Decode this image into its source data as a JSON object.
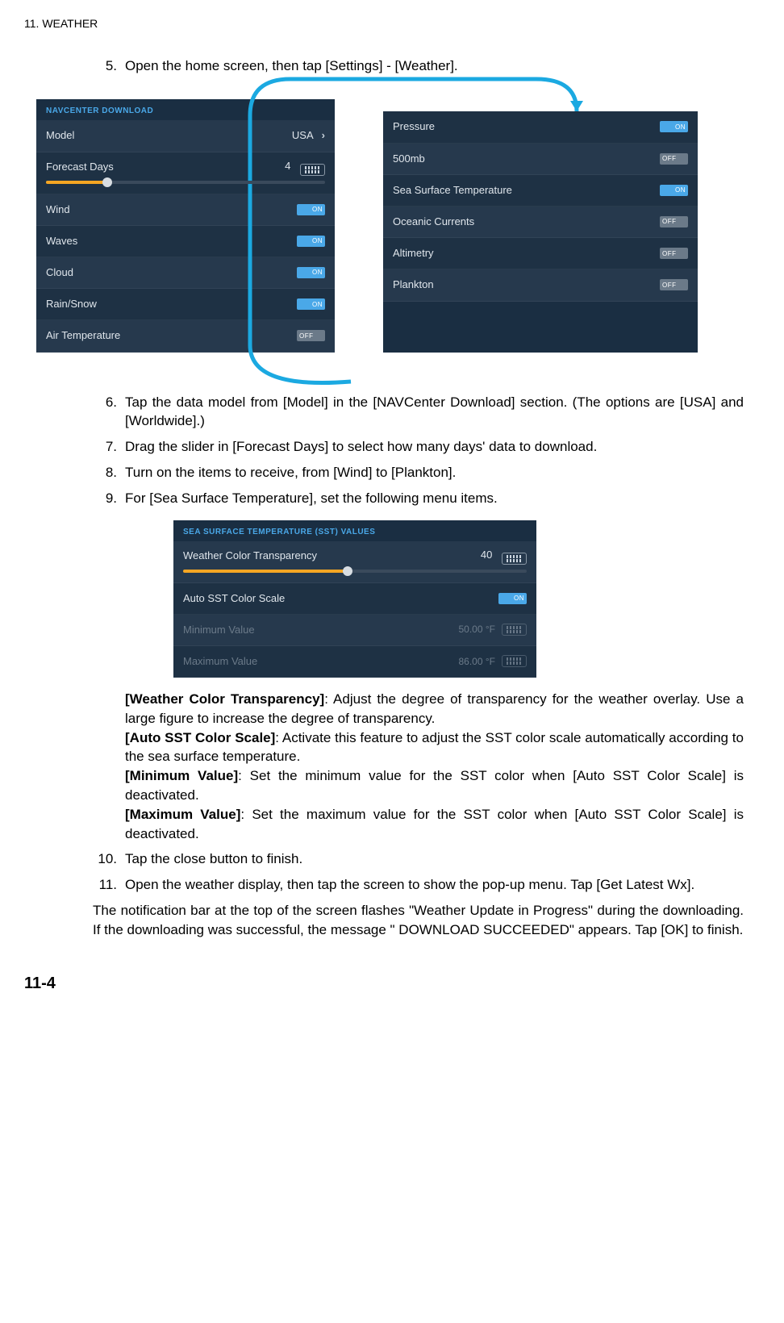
{
  "header": {
    "chapter": "11.  WEATHER"
  },
  "steps": {
    "s5": {
      "num": "5.",
      "text": "Open the home screen, then tap [Settings] - [Weather]."
    },
    "s6": {
      "num": "6.",
      "text": "Tap the data model from [Model] in the [NAVCenter Download] section. (The options are [USA] and [Worldwide].)"
    },
    "s7": {
      "num": "7.",
      "text": "Drag the slider in [Forecast Days] to select how many days' data to download."
    },
    "s8": {
      "num": "8.",
      "text": "Turn on the items to receive, from [Wind] to [Plankton]."
    },
    "s9": {
      "num": "9.",
      "text": "For [Sea Surface Temperature], set the following menu items."
    },
    "s10": {
      "num": "10.",
      "text": "Tap the close button to finish."
    },
    "s11": {
      "num": "11.",
      "text": "Open the weather display, then tap the screen to show the pop-up menu. Tap [Get Latest Wx]."
    }
  },
  "panelLeft": {
    "header": "NAVCENTER DOWNLOAD",
    "model": {
      "label": "Model",
      "value": "USA"
    },
    "forecast": {
      "label": "Forecast Days",
      "value": "4",
      "fillPercent": 22
    },
    "items": {
      "wind": {
        "label": "Wind",
        "state": "ON"
      },
      "waves": {
        "label": "Waves",
        "state": "ON"
      },
      "cloud": {
        "label": "Cloud",
        "state": "ON"
      },
      "rain": {
        "label": "Rain/Snow",
        "state": "ON"
      },
      "airtemp": {
        "label": "Air Temperature",
        "state": "OFF"
      }
    }
  },
  "panelRight": {
    "items": {
      "pressure": {
        "label": "Pressure",
        "state": "ON"
      },
      "mb500": {
        "label": "500mb",
        "state": "OFF"
      },
      "sst": {
        "label": "Sea Surface Temperature",
        "state": "ON"
      },
      "currents": {
        "label": "Oceanic Currents",
        "state": "OFF"
      },
      "altimetry": {
        "label": "Altimetry",
        "state": "OFF"
      },
      "plankton": {
        "label": "Plankton",
        "state": "OFF"
      }
    }
  },
  "sstPanel": {
    "header": "SEA SURFACE TEMPERATURE (SST) VALUES",
    "transparency": {
      "label": "Weather Color Transparency",
      "value": "40",
      "fillPercent": 48
    },
    "autoScale": {
      "label": "Auto SST Color Scale",
      "state": "ON"
    },
    "minVal": {
      "label": "Minimum Value",
      "value": "50.00 °F"
    },
    "maxVal": {
      "label": "Maximum Value",
      "value": "86.00 °F"
    }
  },
  "desc": {
    "wct_b": "[Weather Color Transparency]",
    "wct": ": Adjust the degree of transparency for the weather overlay. Use a large figure to increase the degree of transparency.",
    "auto_b": "[Auto SST Color Scale]",
    "auto": ": Activate this feature to adjust the SST color scale automatically according to the sea surface temperature.",
    "min_b": "[Minimum Value]",
    "min": ": Set the minimum value for the SST color when [Auto SST Color Scale] is deactivated.",
    "max_b": "[Maximum Value]",
    "max": ": Set the maximum value for the SST color when [Auto SST Color Scale] is deactivated."
  },
  "closing": "The notification bar at the top of the screen flashes \"Weather Update in Progress\" during the downloading. If the downloading was successful, the message \" DOWNLOAD SUCCEEDED\" appears. Tap [OK] to finish.",
  "pageNum": "11-4"
}
